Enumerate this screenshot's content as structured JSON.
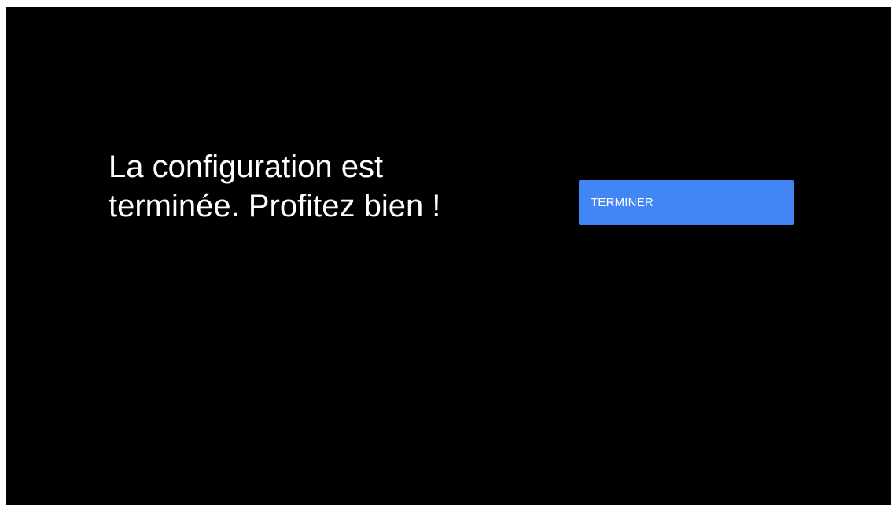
{
  "screen": {
    "message_line1": "La configuration est",
    "message_line2": "terminée. Profitez bien !"
  },
  "finish_button": {
    "label": "TERMINER"
  },
  "colors": {
    "background": "#000000",
    "accent": "#4285F4",
    "text": "#FFFFFF"
  }
}
